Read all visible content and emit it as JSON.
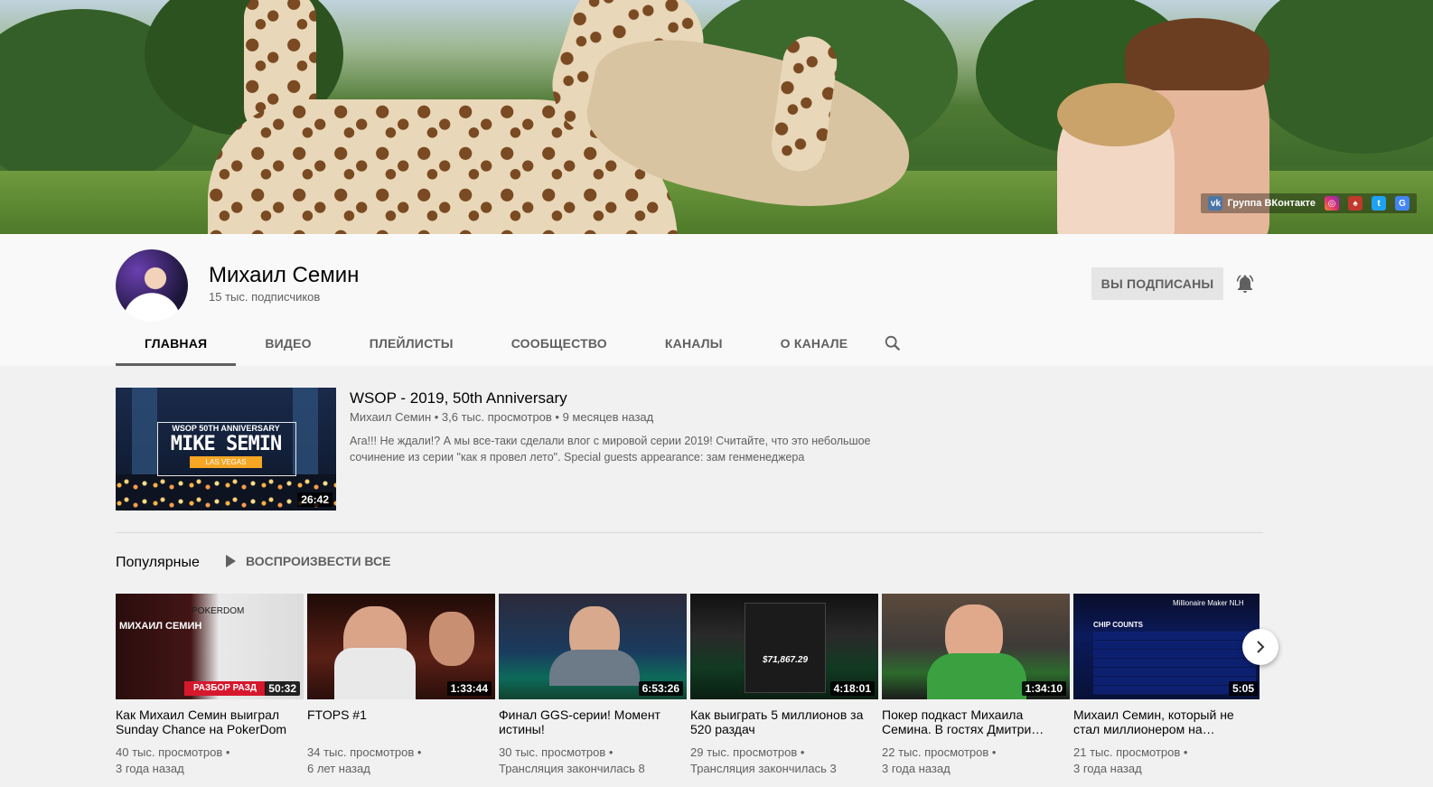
{
  "banner": {
    "social_label": "Группа ВКонтакте",
    "icons": [
      "vk-icon",
      "instagram-icon",
      "pokerdom-icon",
      "twitter-icon",
      "google-icon"
    ]
  },
  "channel": {
    "name": "Михаил Семин",
    "subscribers": "15 тыс. подписчиков",
    "subscribe_label": "ВЫ ПОДПИСАНЫ"
  },
  "tabs": [
    {
      "label": "ГЛАВНАЯ",
      "active": true
    },
    {
      "label": "ВИДЕО"
    },
    {
      "label": "ПЛЕЙЛИСТЫ"
    },
    {
      "label": "СООБЩЕСТВО"
    },
    {
      "label": "КАНАЛЫ"
    },
    {
      "label": "О КАНАЛЕ"
    }
  ],
  "featured": {
    "thumb_line1": "WSOP 50TH ANNIVERSARY",
    "thumb_line2": "MIKE SEMIN",
    "thumb_line3": "LAS VEGAS",
    "duration": "26:42",
    "title": "WSOP - 2019, 50th Anniversary",
    "meta": "Михаил Семин • 3,6 тыс. просмотров • 9 месяцев назад",
    "description": "Ага!!! Не ждали!? А мы все-таки сделали влог с мировой серии 2019! Считайте, что это небольшое сочинение из серии \"как я провел лето\". Special guests appearance: зам генменеджера"
  },
  "popular": {
    "title": "Популярные",
    "play_all": "ВОСПРОИЗВЕСТИ ВСЕ",
    "videos": [
      {
        "duration": "50:32",
        "title": "Как Михаил Семин выиграл Sunday Chance на PokerDom",
        "views": "40 тыс. просмотров •",
        "age": "3 года назад",
        "thumb_text": "МИХАИЛ СЕМИН",
        "thumb_text2": "POKERDOM",
        "thumb_text3": "РАЗБОР РАЗД"
      },
      {
        "duration": "1:33:44",
        "title": "FTOPS #1",
        "views": "34 тыс. просмотров •",
        "age": "6 лет назад"
      },
      {
        "duration": "6:53:26",
        "title": "Финал GGS-серии! Момент истины!",
        "views": "30 тыс. просмотров •",
        "age": "Трансляция закончилась 8"
      },
      {
        "duration": "4:18:01",
        "title": "Как выиграть 5 миллионов за 520 раздач",
        "views": "29 тыс. просмотров •",
        "age": "Трансляция закончилась 3",
        "thumb_text": "$71,867.29"
      },
      {
        "duration": "1:34:10",
        "title": "Покер подкаст Михаила Семина. В гостях Дмитри…",
        "views": "22 тыс. просмотров •",
        "age": "3 года назад"
      },
      {
        "duration": "5:05",
        "title": "Михаил Семин, который не стал миллионером на…",
        "views": "21 тыс. просмотров •",
        "age": "3 года назад",
        "thumb_text": "CHIP COUNTS",
        "thumb_text2": "Millionaire Maker NLH"
      }
    ]
  }
}
